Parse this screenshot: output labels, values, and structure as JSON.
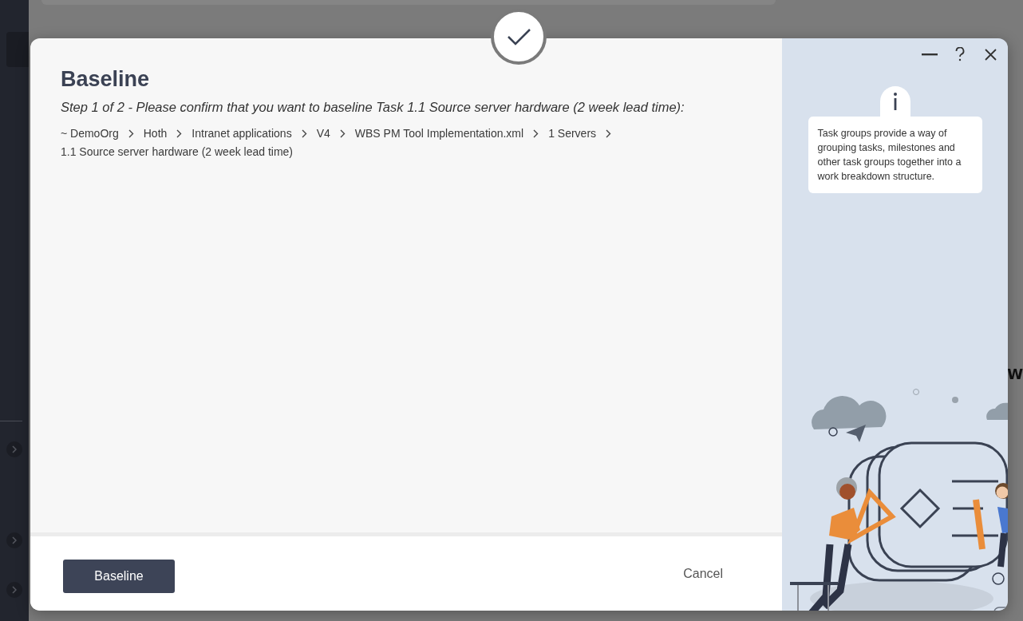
{
  "background": {
    "edge_texts": [
      {
        "kind": "right",
        "text": "W"
      }
    ]
  },
  "dialog": {
    "title": "Baseline",
    "step": "Step 1 of 2 - Please confirm that you want to baseline Task 1.1 Source server hardware (2 week lead time):",
    "path": [
      "~ DemoOrg",
      "Hoth",
      "Intranet applications",
      "V4",
      "WBS PM Tool Implementation.xml",
      "1 Servers",
      "1.1 Source server hardware (2 week lead time)"
    ],
    "primary_button": "Baseline",
    "cancel_button": "Cancel",
    "help_text": "Task groups provide a way of grouping tasks, milestones and other task groups together into a work breakdown structure."
  }
}
